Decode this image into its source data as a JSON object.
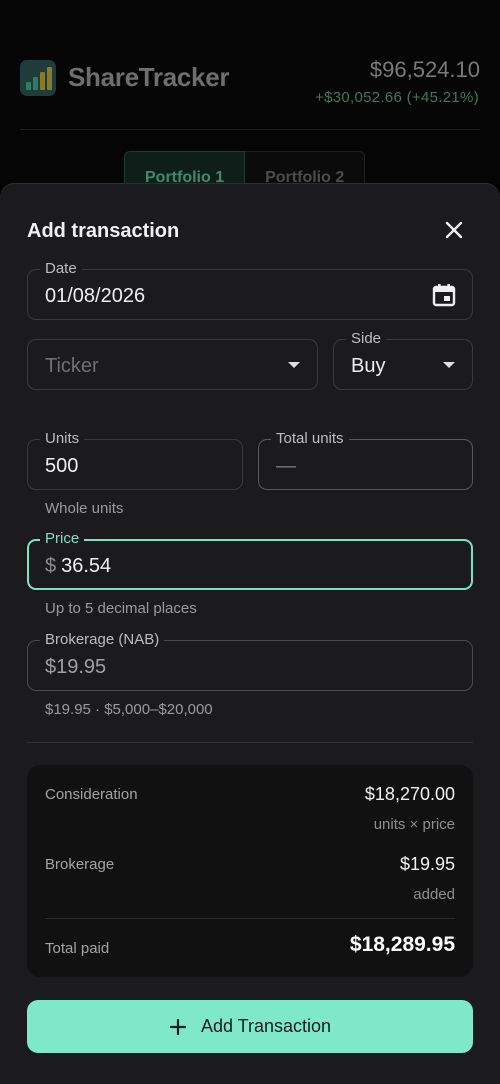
{
  "header": {
    "app_name": "ShareTracker",
    "total_value": "$96,524.10",
    "total_change": "+$30,052.66 (+45.21%)"
  },
  "tabs": [
    {
      "label": "Portfolio 1",
      "active": true
    },
    {
      "label": "Portfolio 2",
      "active": false
    }
  ],
  "sheet": {
    "title": "Add transaction",
    "close_icon": "close-icon"
  },
  "form": {
    "date": {
      "label": "Date",
      "value": "01/08/2026",
      "icon": "calendar-icon"
    },
    "ticker": {
      "placeholder": "Ticker"
    },
    "side": {
      "label": "Side",
      "value": "Buy"
    },
    "units": {
      "label": "Units",
      "value": "500",
      "helper": "Whole units"
    },
    "total_units": {
      "label": "Total units",
      "value": "—"
    },
    "price": {
      "label": "Price",
      "prefix": "$",
      "value": "36.54",
      "helper": "Up to 5 decimal places"
    },
    "brokerage": {
      "label": "Brokerage (NAB)",
      "value": "$19.95",
      "helper": "$19.95 · $5,000–$20,000"
    }
  },
  "summary": {
    "consideration_label": "Consideration",
    "consideration_value": "$18,270.00",
    "consideration_sub": "units × price",
    "brokerage_label": "Brokerage",
    "brokerage_value": "$19.95",
    "brokerage_sub": "added",
    "total_label": "Total paid",
    "total_value": "$18,289.95"
  },
  "actions": {
    "add_label": "Add Transaction"
  },
  "colors": {
    "accent": "#7ee8c9",
    "focus_border": "#7ee0c3",
    "sheet_bg": "#1b1b1d",
    "summary_bg": "#111112"
  }
}
